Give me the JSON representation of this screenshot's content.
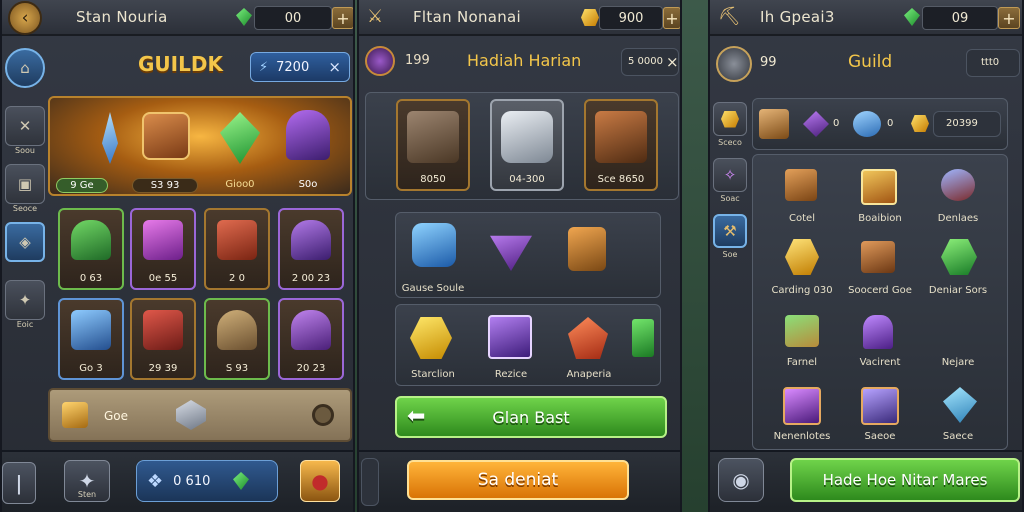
{
  "colors": {
    "accent_gold": "#f3c64a",
    "panel": "#343944",
    "blue": "#2f5f9e",
    "green": "#4caf2f",
    "orange": "#f09a20"
  },
  "panel1": {
    "title": "Stan Nouria",
    "gems": "00",
    "plus": "+",
    "header": "GUILDK",
    "pill_value": "7200",
    "pill_close": "×",
    "tabs": [
      {
        "icon": "⌂",
        "label": ""
      },
      {
        "icon": "✕",
        "label": "Soou"
      },
      {
        "icon": "▣",
        "label": "Seoce"
      },
      {
        "icon": "◈",
        "label": ""
      },
      {
        "icon": "✦",
        "label": "Eoic"
      }
    ],
    "featured": [
      {
        "label": "9 Ge",
        "icon": "crystal-blade-icon"
      },
      {
        "label": "S3 93",
        "icon": "chest-icon"
      },
      {
        "label": "Gioo0",
        "icon": "emerald-icon"
      },
      {
        "label": "S0o",
        "icon": "dark-hero-icon"
      }
    ],
    "row1": [
      "0 63",
      "0e 55",
      "2 0",
      "2 00 23"
    ],
    "row2": [
      "Go 3",
      "29 39",
      "S 93",
      "20 23"
    ],
    "bottom_label": "Goe",
    "footer": {
      "left_label": "Sten",
      "value": "0 610"
    }
  },
  "panel2": {
    "title": "Fltan Nonanai",
    "gold": "900",
    "plus": "+",
    "header_left": "199",
    "header": "Hadiah Harian",
    "header_right": "5 0000",
    "header_close": "×",
    "top": [
      "8050",
      "04-300",
      "Sce 8650"
    ],
    "mid_label": "Gause Soule",
    "row": [
      "Starclion",
      "Rezice",
      "Anaperia"
    ],
    "green_button": "Glan Bast",
    "orange_button": "Sa deniat"
  },
  "panel3": {
    "title": "Ih Gpeai3",
    "gems": "09",
    "plus": "+",
    "header_left": "99",
    "header": "Guild",
    "header_right": "ttt0",
    "side": [
      {
        "label": "Sceco"
      },
      {
        "label": "Soac"
      },
      {
        "label": "Soe"
      }
    ],
    "stats": {
      "a": "0",
      "b": "0",
      "gold": "20399"
    },
    "grid": [
      "Cotel",
      "Boaibion",
      "Denlaes",
      "Carding 030",
      "Soocerd Goe",
      "Deniar Sors",
      "Farnel",
      "Vacirent",
      "Nejare",
      "Nenenlotes",
      "Saeoe",
      "Saece"
    ],
    "button": "Hade Hoe Nitar Mares"
  }
}
